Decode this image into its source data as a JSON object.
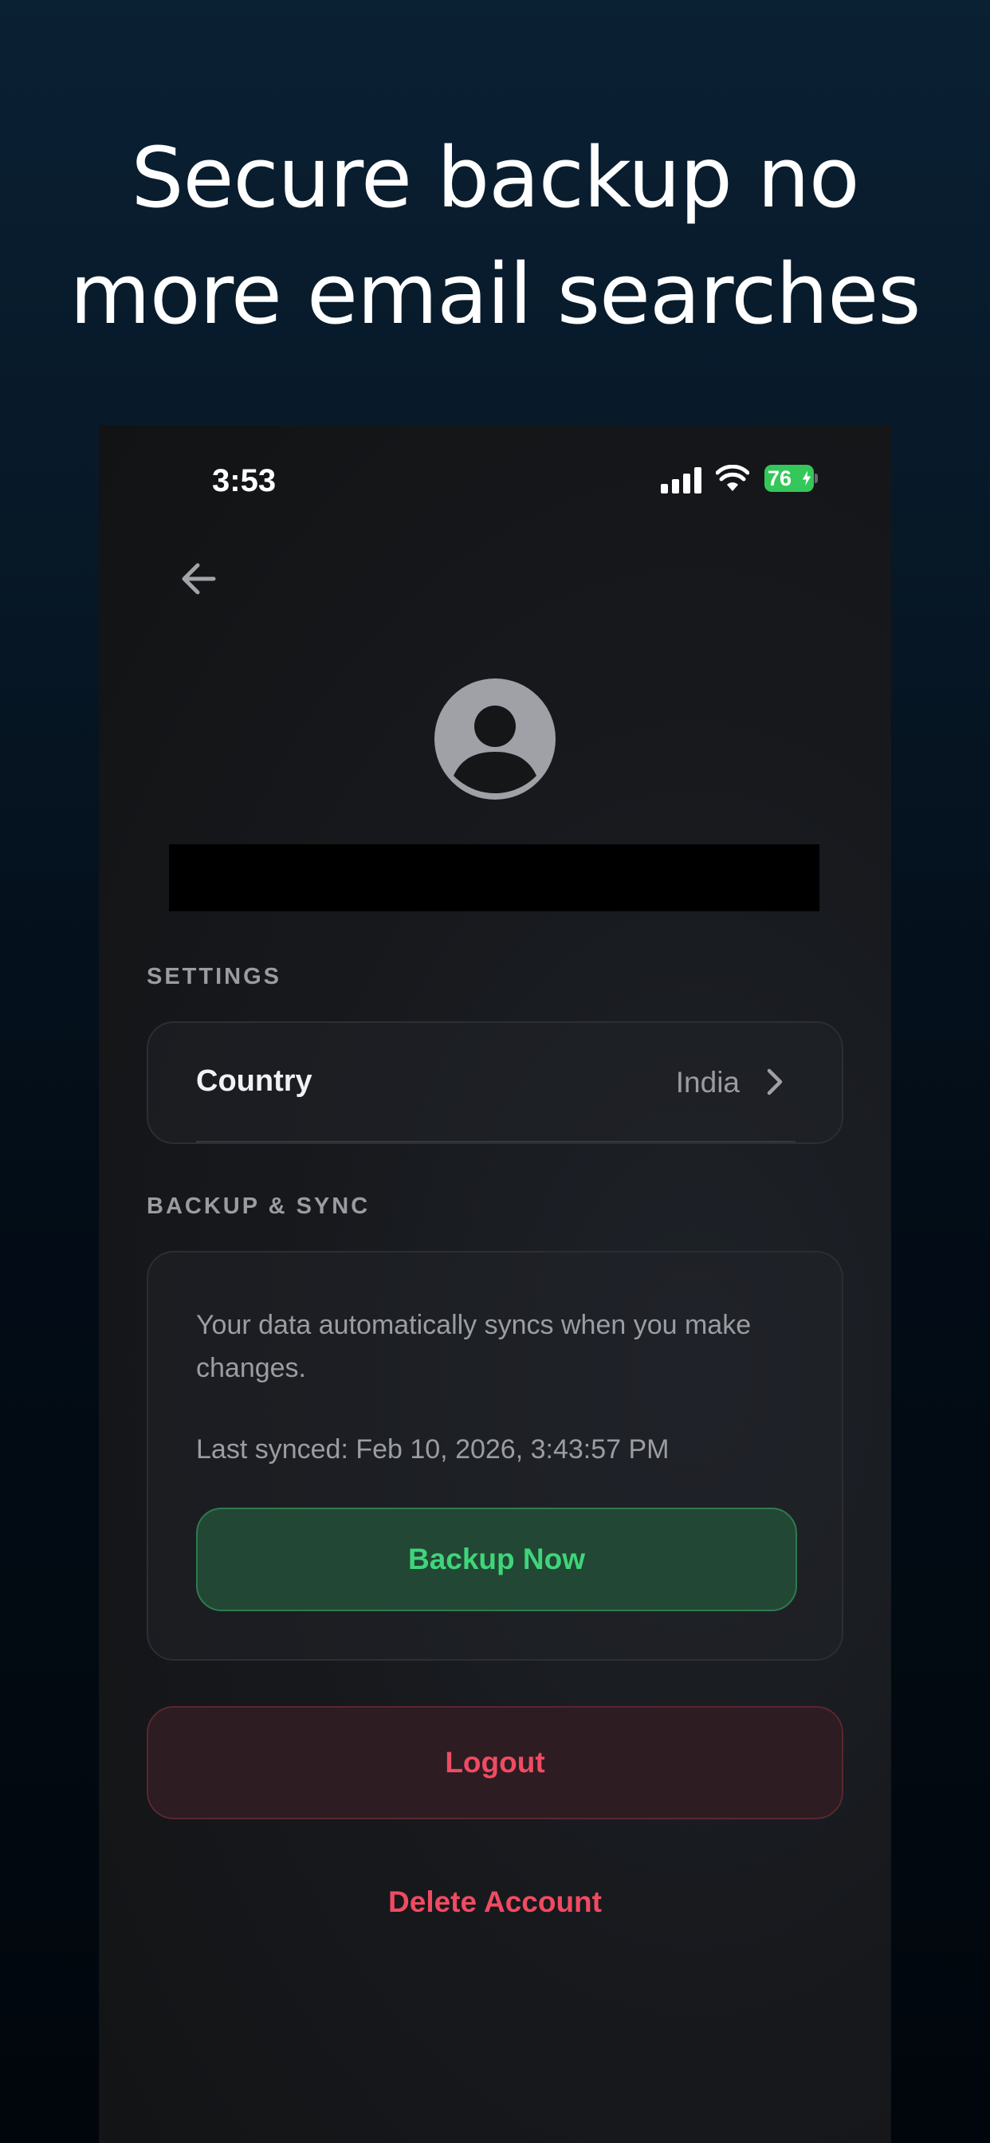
{
  "headline": {
    "line1": "Secure backup no",
    "line2": "more email searches"
  },
  "status_bar": {
    "time": "3:53",
    "battery": "76"
  },
  "icons": {
    "back": "arrow-left-icon",
    "avatar": "person-circle-icon",
    "chevron": "chevron-right-icon",
    "signal": "cellular-signal-icon",
    "wifi": "wifi-icon",
    "battery": "battery-charging-icon"
  },
  "settings": {
    "section_label": "SETTINGS",
    "country_label": "Country",
    "country_value": "India"
  },
  "backup_sync": {
    "section_label": "BACKUP & SYNC",
    "description": "Your data automatically syncs when you make changes.",
    "last_synced": "Last synced: Feb 10, 2026, 3:43:57 PM",
    "backup_button": "Backup Now"
  },
  "actions": {
    "logout": "Logout",
    "delete_account": "Delete Account"
  },
  "colors": {
    "accent_green": "#3fd57a",
    "danger_red": "#ef4b62",
    "battery_green": "#34c759"
  }
}
